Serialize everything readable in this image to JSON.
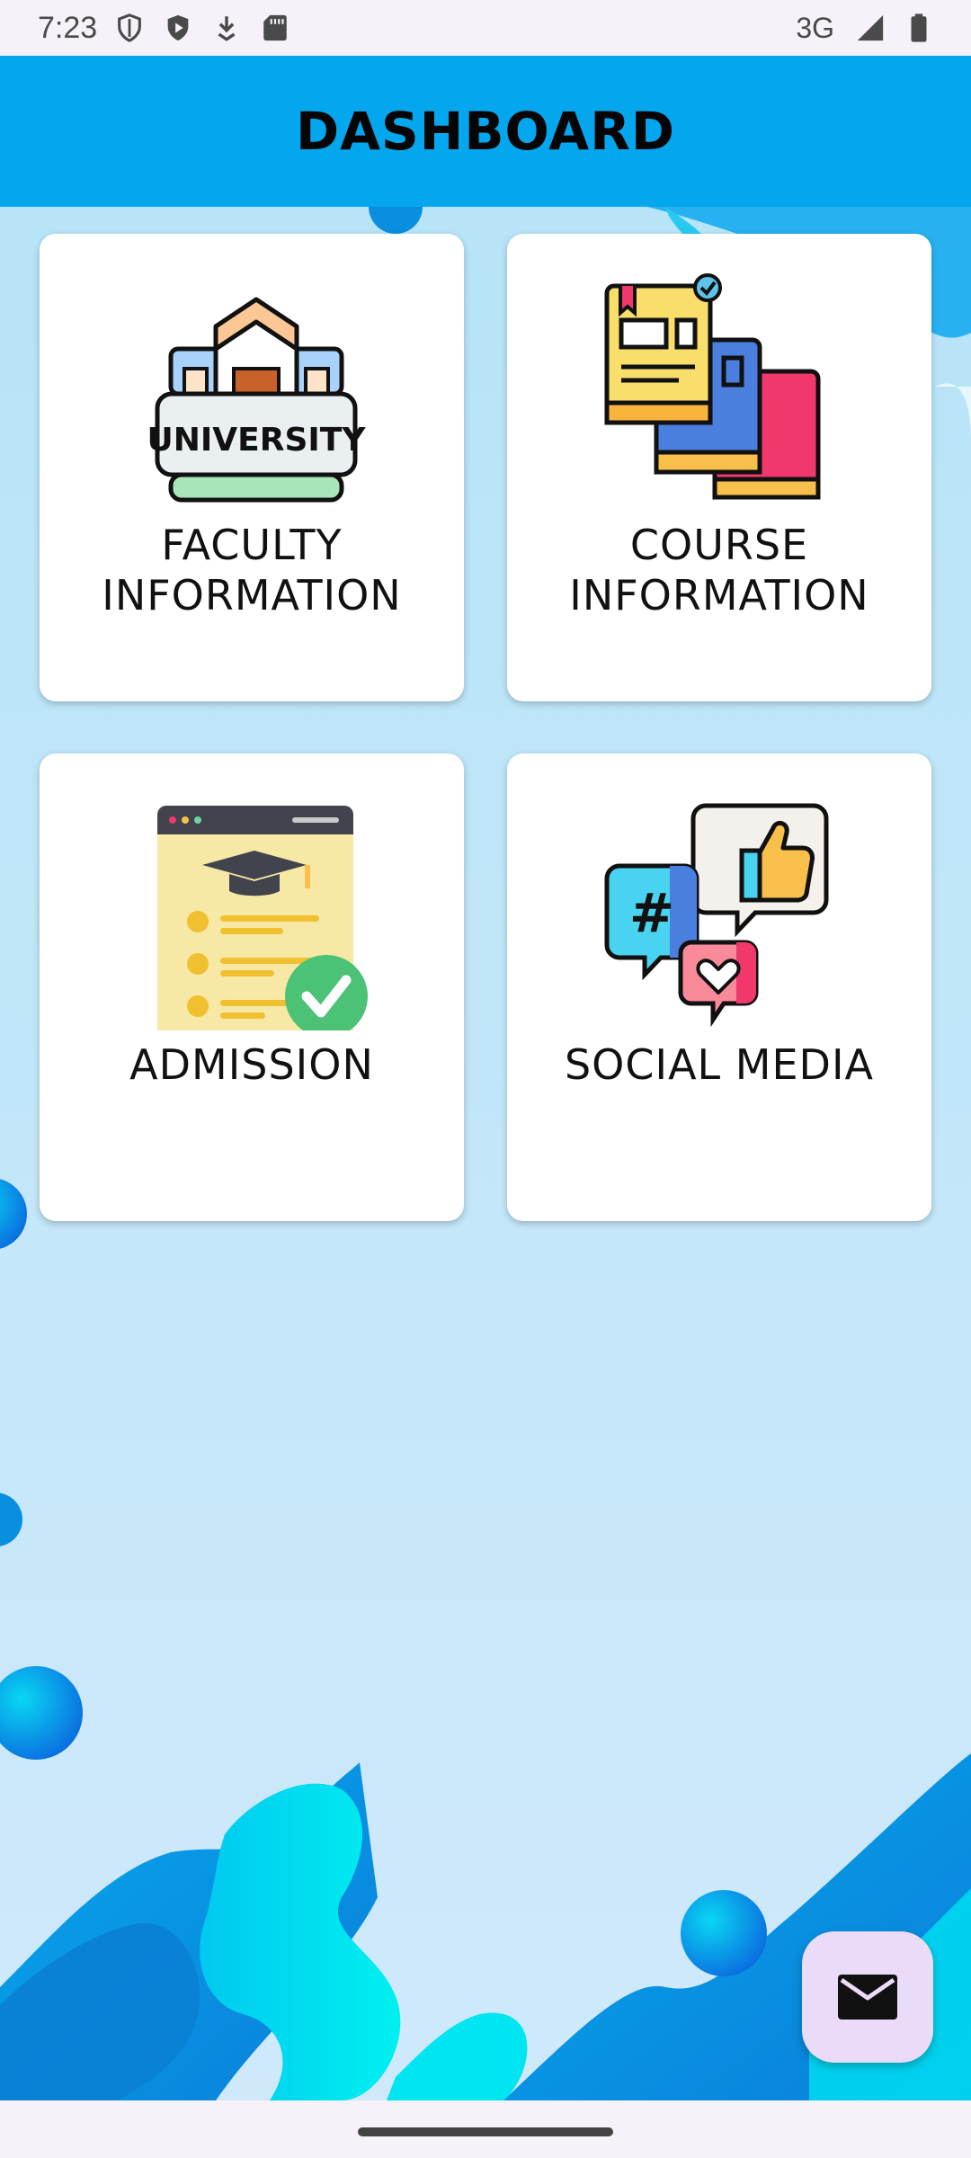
{
  "status_bar": {
    "time": "7:23",
    "network": "3G",
    "left_icons": [
      "shield-icon",
      "play-protect-icon",
      "download-icon",
      "sd-card-icon"
    ],
    "right_icons": [
      "signal-icon",
      "battery-icon"
    ]
  },
  "header": {
    "title": "DASHBOARD",
    "background_color": "#04a7ee"
  },
  "cards": [
    {
      "line1": "FACULTY",
      "line2": "INFORMATION",
      "icon": "university-icon",
      "icon_text": "UNIVERSITY"
    },
    {
      "line1": "COURSE",
      "line2": "INFORMATION",
      "icon": "books-icon"
    },
    {
      "line1": "ADMISSION",
      "line2": "",
      "icon": "admission-form-icon"
    },
    {
      "line1": "SOCIAL MEDIA",
      "line2": "",
      "icon": "social-media-icon"
    }
  ],
  "fab": {
    "icon": "mail-icon",
    "background_color": "#eadcf9"
  },
  "colors": {
    "background": "#c9e8f9",
    "accent_cyan": "#00d8f0",
    "accent_blue": "#0a8fe0"
  }
}
